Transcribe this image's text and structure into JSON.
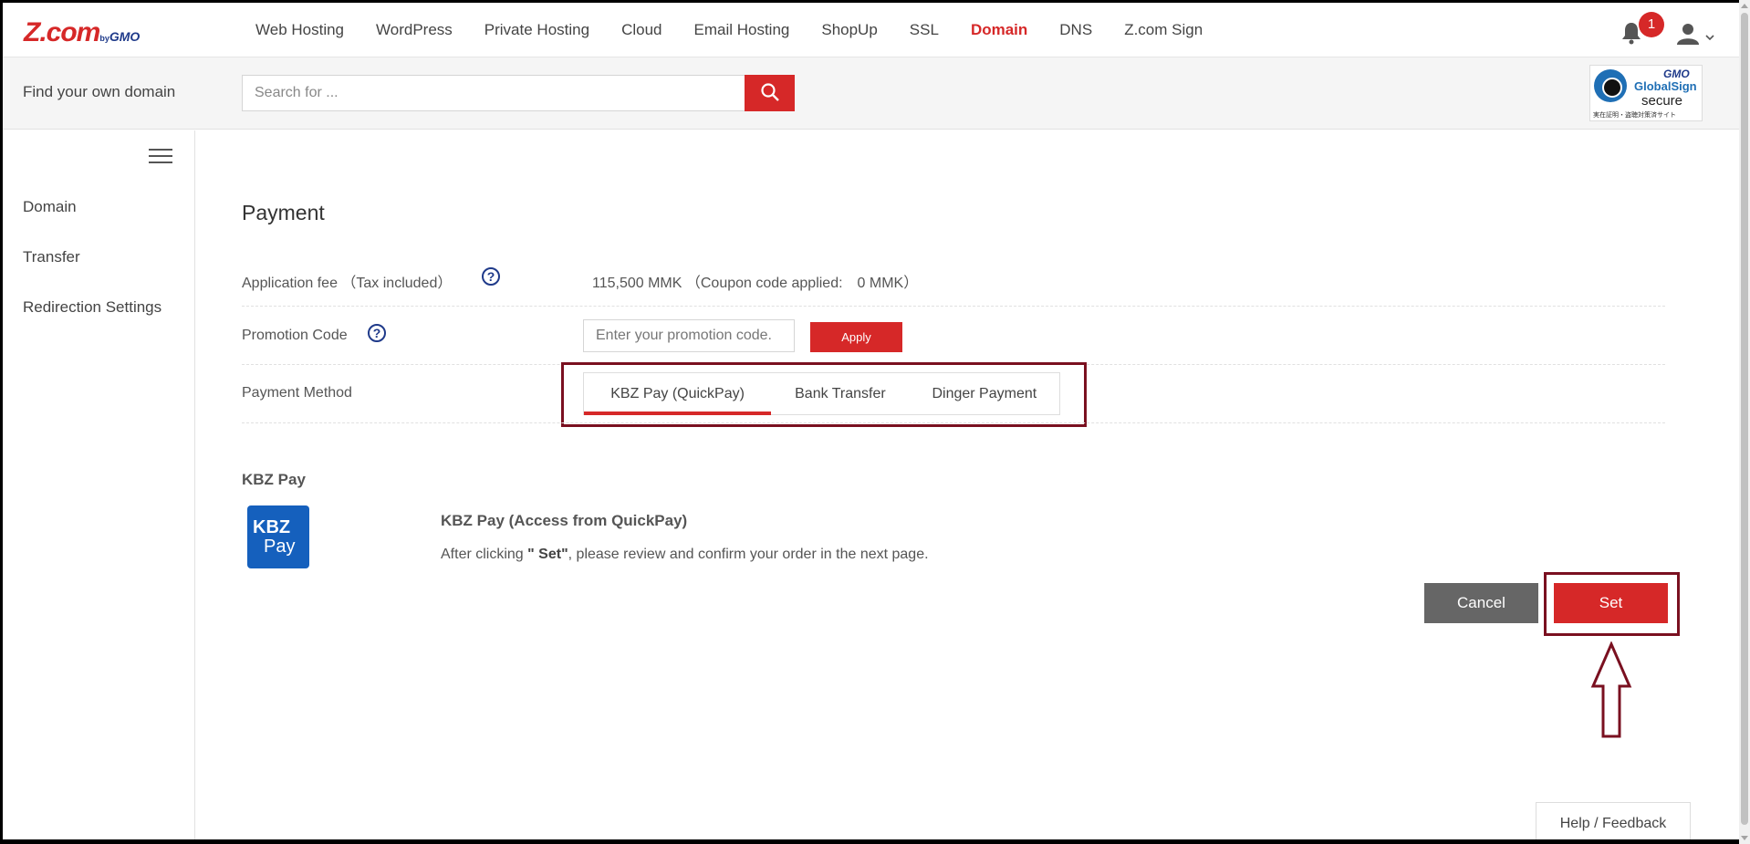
{
  "logo": {
    "brand": "Z.com",
    "by": "by",
    "gmo": "GMO"
  },
  "nav": {
    "items": [
      {
        "label": "Web Hosting",
        "active": false
      },
      {
        "label": "WordPress",
        "active": false
      },
      {
        "label": "Private Hosting",
        "active": false
      },
      {
        "label": "Cloud",
        "active": false
      },
      {
        "label": "Email Hosting",
        "active": false
      },
      {
        "label": "ShopUp",
        "active": false
      },
      {
        "label": "SSL",
        "active": false
      },
      {
        "label": "Domain",
        "active": true
      },
      {
        "label": "DNS",
        "active": false
      },
      {
        "label": "Z.com Sign",
        "active": false
      }
    ],
    "notification_count": "1"
  },
  "search": {
    "label": "Find your own domain",
    "placeholder": "Search for ..."
  },
  "globalsign": {
    "line1": "GMO",
    "line2": "GlobalSign",
    "line3": "secure",
    "line4": "実在証明・盗聴対策済サイト"
  },
  "sidebar": {
    "items": [
      {
        "label": "Domain"
      },
      {
        "label": "Transfer"
      },
      {
        "label": "Redirection Settings"
      }
    ]
  },
  "payment": {
    "title": "Payment",
    "fee_label": "Application fee （Tax included）",
    "fee_value": "115,500 MMK （Coupon code applied:　0 MMK）",
    "promo_label": "Promotion Code",
    "promo_placeholder": "Enter your promotion code.",
    "apply_label": "Apply",
    "method_label": "Payment Method",
    "tabs": [
      {
        "label": "KBZ Pay (QuickPay)",
        "active": true
      },
      {
        "label": "Bank Transfer",
        "active": false
      },
      {
        "label": "Dinger Payment",
        "active": false
      }
    ],
    "section_title": "KBZ Pay",
    "kbz_logo_top": "KBZ",
    "kbz_logo_bottom": "Pay",
    "kbz_name": "KBZ Pay (Access from QuickPay)",
    "kbz_desc_pre": "After clicking ",
    "kbz_desc_bold": "\" Set\"",
    "kbz_desc_post": ", please review and confirm your order in the next page.",
    "cancel_label": "Cancel",
    "set_label": "Set"
  },
  "help_feedback": "Help / Feedback",
  "colors": {
    "accent": "#d62828",
    "highlight_border": "#7a1020",
    "kbz_blue": "#1560bd"
  }
}
